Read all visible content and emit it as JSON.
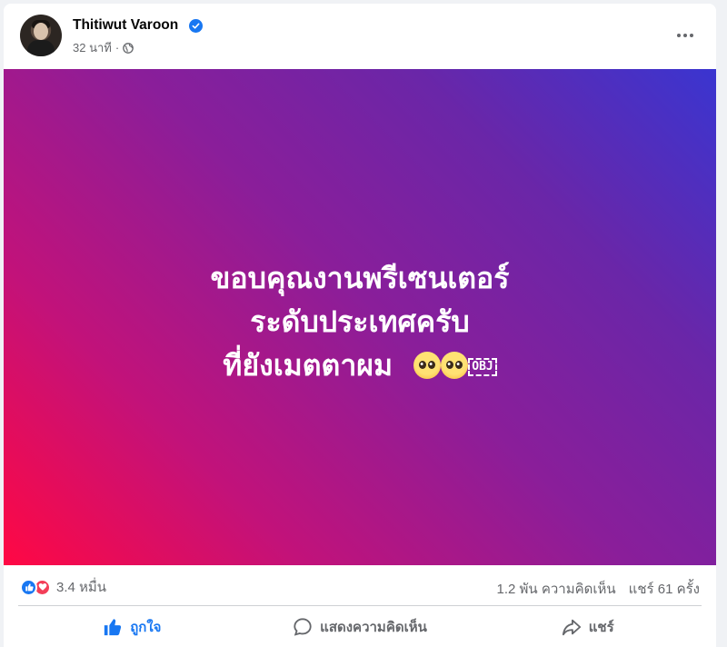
{
  "post": {
    "author": "Thitiwut Varoon",
    "time": "32 นาที",
    "separator": "·",
    "text_lines": [
      "ขอบคุณงานพรีเซนเตอร์",
      "ระดับประเทศครับ",
      "ที่ยังเมตตาผม"
    ],
    "text_trailing_glyph": "OBJ",
    "background_gradient": [
      "#ff0844",
      "#c2127a",
      "#8a1e9a",
      "#6a26a8",
      "#3a35d0"
    ]
  },
  "stats": {
    "reactions_count": "3.4 หมื่น",
    "comments": "1.2 พัน ความคิดเห็น",
    "shares": "แชร์ 61 ครั้ง"
  },
  "actions": {
    "like_label": "ถูกใจ",
    "comment_label": "แสดงความคิดเห็น",
    "share_label": "แชร์"
  },
  "icons": {
    "verified": "verified-badge-icon",
    "audience": "globe-icon",
    "more": "more-options-icon",
    "like_reaction": "like-reaction-icon",
    "love_reaction": "love-reaction-icon",
    "like_action": "thumbs-up-icon",
    "comment_action": "comment-bubble-icon",
    "share_action": "share-arrow-icon",
    "emoji": "pleading-face-icon"
  },
  "colors": {
    "accent": "#1877f2",
    "love": "#f33e58",
    "secondary_text": "#65676b"
  }
}
